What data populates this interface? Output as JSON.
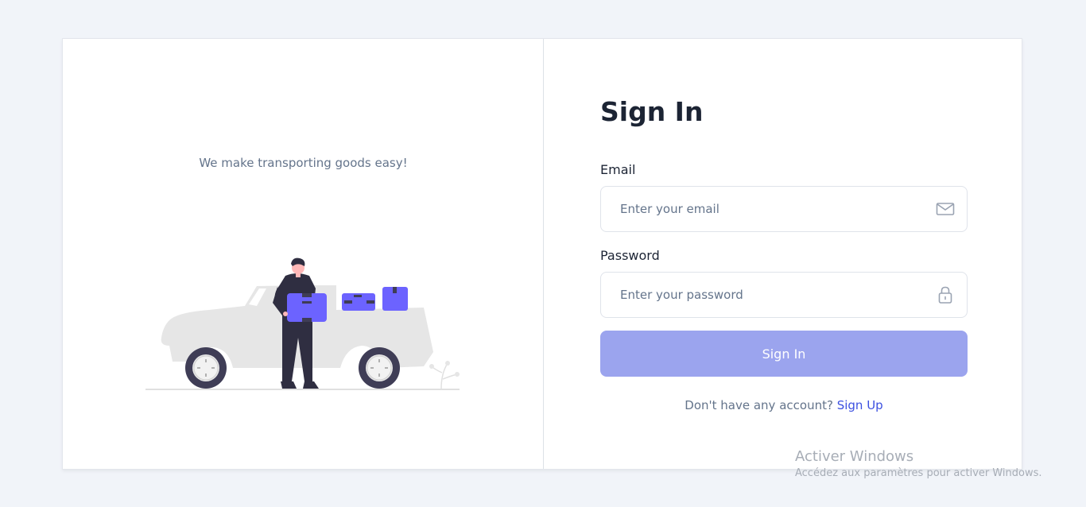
{
  "left": {
    "tagline": "We make transporting goods easy!"
  },
  "form": {
    "title": "Sign In",
    "email": {
      "label": "Email",
      "placeholder": "Enter your email",
      "icon": "mail-icon"
    },
    "password": {
      "label": "Password",
      "placeholder": "Enter your password",
      "icon": "lock-icon"
    },
    "submit_label": "Sign In",
    "signup_prompt": "Don't have any account?",
    "signup_link": "Sign Up"
  },
  "watermark": {
    "title": "Activer Windows",
    "subtitle": "Accédez aux paramètres pour activer Windows."
  },
  "colors": {
    "background": "#f1f4f9",
    "primary_button": "#9ba4ee",
    "link": "#3c50e0",
    "heading": "#1c2434",
    "illustration_accent": "#6c63ff"
  }
}
